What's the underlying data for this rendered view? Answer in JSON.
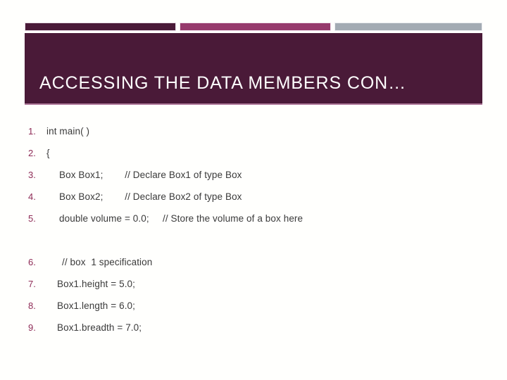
{
  "slide": {
    "title": "ACCESSING THE DATA MEMBERS CON…",
    "colors": {
      "header_background": "#4A1A38",
      "bar_dark": "#4A1A38",
      "bar_magenta": "#963A6C",
      "bar_gray": "#A3ABB3",
      "title_text": "#FFFFFF",
      "number_text": "#8E2B56",
      "body_text": "#3A3A3A",
      "background": "#FFFFFD",
      "header_bottom_rule": "#B07A9B"
    },
    "list": [
      {
        "number": "1.",
        "text": "int main( )",
        "indent": 0
      },
      {
        "number": "2.",
        "text": "{",
        "indent": 0
      },
      {
        "number": "3.",
        "text": "Box Box1;        // Declare Box1 of type Box",
        "indent": 1
      },
      {
        "number": "4.",
        "text": "Box Box2;        // Declare Box2 of type Box",
        "indent": 1
      },
      {
        "number": "5.",
        "text": "double volume = 0.0;     // Store the volume of a box here",
        "indent": 1
      },
      {
        "number": "",
        "text": "",
        "indent": 0
      },
      {
        "number": "6.",
        "text": "// box  1 specification",
        "indent": 2
      },
      {
        "number": "7.",
        "text": "Box1.height = 5.0;",
        "indent": 3
      },
      {
        "number": "8.",
        "text": "Box1.length = 6.0;",
        "indent": 3
      },
      {
        "number": "9.",
        "text": "Box1.breadth = 7.0;",
        "indent": 3
      }
    ]
  }
}
